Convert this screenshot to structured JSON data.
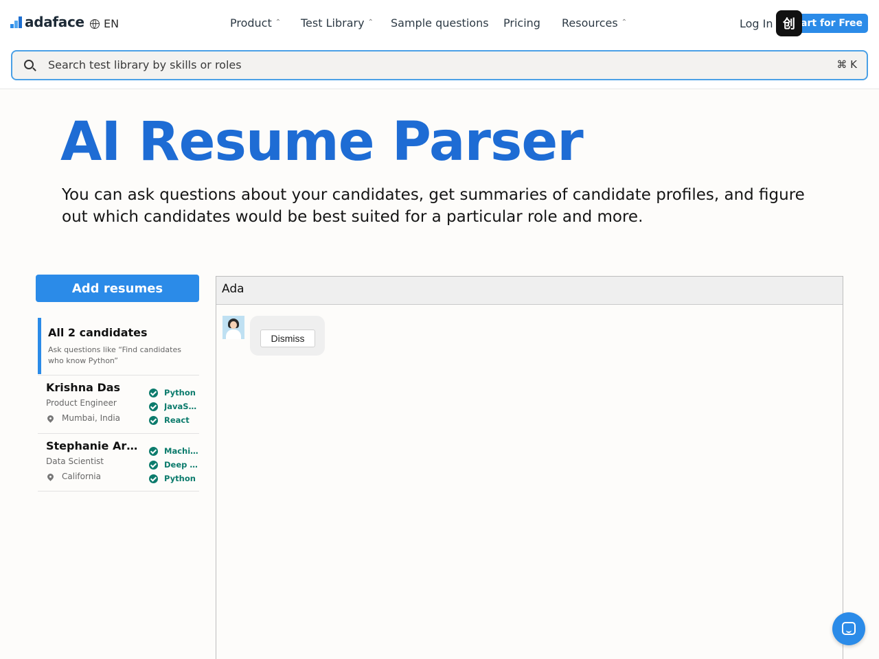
{
  "header": {
    "brand": "adaface",
    "language": "EN",
    "nav": [
      {
        "label": "Product",
        "has_caret": true
      },
      {
        "label": "Test Library",
        "has_caret": true
      },
      {
        "label": "Sample questions",
        "has_caret": false
      },
      {
        "label": "Pricing",
        "has_caret": false
      },
      {
        "label": "Resources",
        "has_caret": true
      }
    ],
    "login": "Log In",
    "cta_label": "art for Free",
    "overlay_glyph": "创"
  },
  "search": {
    "placeholder": "Search test library by skills or roles",
    "shortcut": "⌘ K"
  },
  "hero": {
    "title": "AI Resume Parser",
    "description": "You can ask questions about your candidates, get summaries of candidate profiles, and figure out which candidates would be best suited for a particular role and more."
  },
  "sidebar": {
    "add_button": "Add resumes",
    "all": {
      "title": "All 2 candidates",
      "subtitle": "Ask questions like “Find candidates who know Python”"
    },
    "candidates": [
      {
        "name": "Krishna Das",
        "role": "Product Engineer",
        "location": "Mumbai, India",
        "skills": [
          "Python",
          "JavaSc…",
          "React"
        ]
      },
      {
        "name": "Stephanie Art…",
        "role": "Data Scientist",
        "location": "California",
        "skills": [
          "Machin…",
          "Deep L…",
          "Python"
        ]
      }
    ]
  },
  "chat": {
    "header_title": "Ada",
    "dismiss_label": "Dismiss"
  },
  "colors": {
    "accent": "#2b8be8",
    "title_blue": "#1e6cd4",
    "skill_green": "#0c7b6c"
  }
}
